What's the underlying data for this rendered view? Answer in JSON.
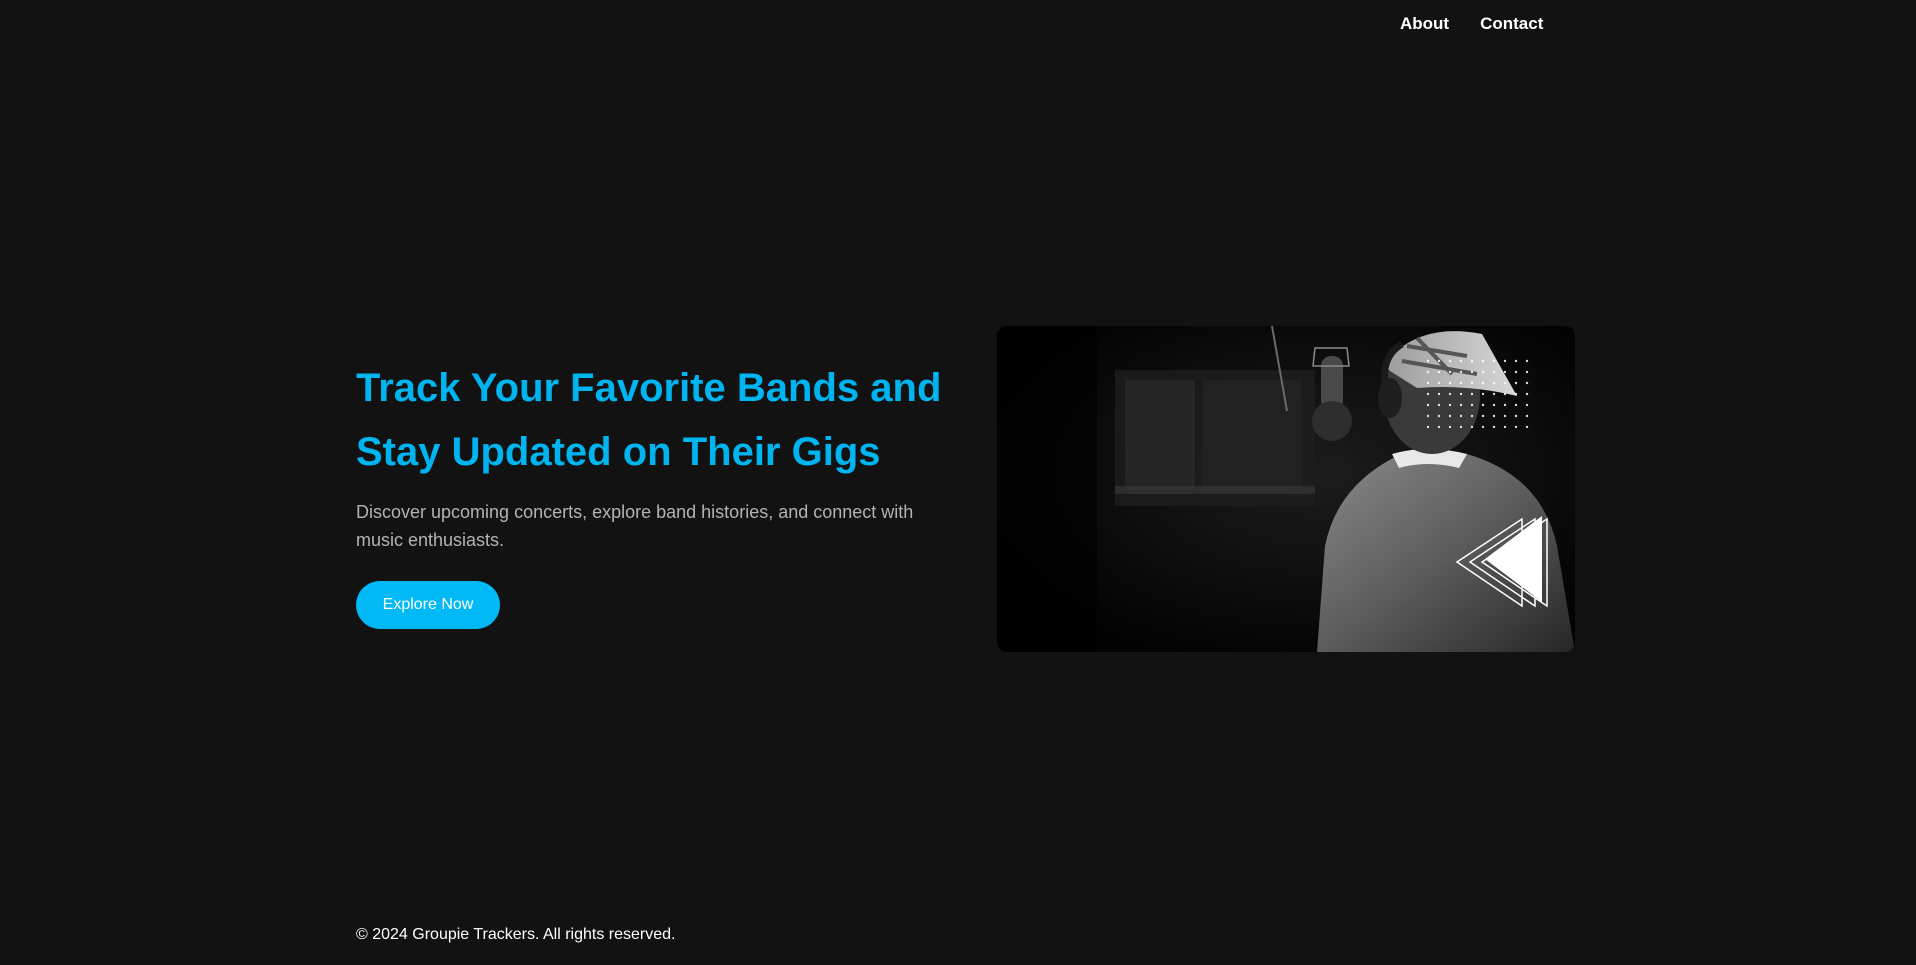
{
  "nav": {
    "about_label": "About",
    "contact_label": "Contact"
  },
  "hero": {
    "title": "Track Your Favorite Bands and Stay Updated on Their Gigs",
    "subtitle": "Discover upcoming concerts, explore band histories, and connect with music enthusiasts.",
    "cta_label": "Explore Now",
    "image_alt": "Musician wearing headphones recording at a studio microphone"
  },
  "footer": {
    "copyright": "© 2024 Groupie Trackers. All rights reserved."
  },
  "colors": {
    "background": "#121212",
    "accent": "#00b4f0",
    "text": "#ffffff",
    "muted": "#b3b3b3"
  }
}
